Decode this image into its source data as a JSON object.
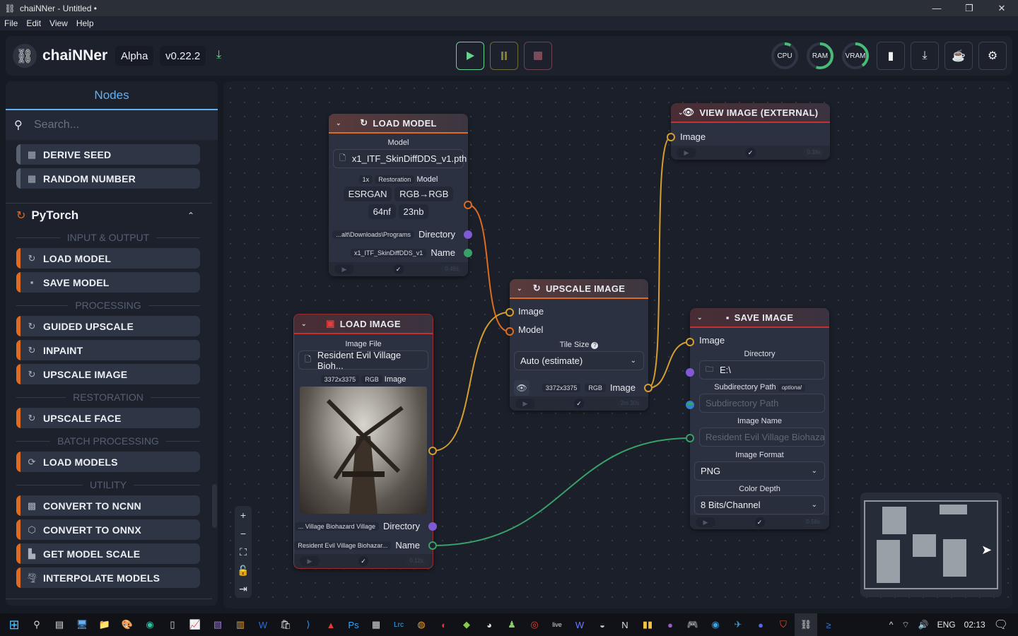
{
  "window": {
    "title": "chaiNNer - Untitled •",
    "controls": [
      "minimize",
      "restore",
      "close"
    ]
  },
  "menu": [
    "File",
    "Edit",
    "View",
    "Help"
  ],
  "header": {
    "brand": "chaiNNer",
    "channel": "Alpha",
    "version": "v0.22.2",
    "run_controls": [
      {
        "name": "run",
        "icon": "play-icon",
        "color": "#68d391"
      },
      {
        "name": "pause",
        "icon": "pause-icon",
        "color": "#7f7a3e"
      },
      {
        "name": "stop",
        "icon": "stop-icon",
        "color": "#7a4b58"
      }
    ],
    "gauges": [
      {
        "label": "CPU",
        "percent": 8
      },
      {
        "label": "RAM",
        "percent": 55
      },
      {
        "label": "VRAM",
        "percent": 40
      }
    ],
    "accent_green": "#48bb78"
  },
  "sidebar": {
    "tab": "Nodes",
    "search_placeholder": "Search...",
    "utility_items": [
      {
        "label": "DERIVE SEED",
        "icon": "calculator-icon"
      },
      {
        "label": "RANDOM NUMBER",
        "icon": "calculator-icon"
      }
    ],
    "category": {
      "name": "PyTorch",
      "color": "#dd6b20"
    },
    "sections": [
      {
        "title": "INPUT & OUTPUT",
        "items": [
          {
            "label": "LOAD MODEL",
            "icon": "pytorch-icon"
          },
          {
            "label": "SAVE MODEL",
            "icon": "save-icon"
          }
        ]
      },
      {
        "title": "PROCESSING",
        "items": [
          {
            "label": "GUIDED UPSCALE",
            "icon": "pytorch-icon"
          },
          {
            "label": "INPAINT",
            "icon": "pytorch-icon"
          },
          {
            "label": "UPSCALE IMAGE",
            "icon": "pytorch-icon"
          }
        ]
      },
      {
        "title": "RESTORATION",
        "items": [
          {
            "label": "UPSCALE FACE",
            "icon": "pytorch-icon"
          }
        ]
      },
      {
        "title": "BATCH PROCESSING",
        "items": [
          {
            "label": "LOAD MODELS",
            "icon": "loop-icon"
          }
        ]
      },
      {
        "title": "UTILITY",
        "items": [
          {
            "label": "CONVERT TO NCNN",
            "icon": "ncnn-icon"
          },
          {
            "label": "CONVERT TO ONNX",
            "icon": "onnx-icon"
          },
          {
            "label": "GET MODEL SCALE",
            "icon": "ruler-icon"
          },
          {
            "label": "INTERPOLATE MODELS",
            "icon": "tornado-icon"
          }
        ]
      }
    ]
  },
  "nodes": {
    "load_model": {
      "title": "LOAD MODEL",
      "model_label": "Model",
      "model_file": "x1_ITF_SkinDiffDDS_v1.pth",
      "tags": [
        "1x",
        "Restoration"
      ],
      "output_label": "Model",
      "chips": [
        "ESRGAN",
        "RGB→RGB",
        "64nf",
        "23nb"
      ],
      "directory_value": "...alt\\Downloads\\Programs",
      "directory_label": "Directory",
      "name_value": "x1_ITF_SkinDiffDDS_v1",
      "name_label": "Name",
      "time": "0.46s"
    },
    "load_image": {
      "title": "LOAD IMAGE",
      "file_label": "Image File",
      "file_value": "Resident Evil  Village Bioh...",
      "dims": "3372x3375",
      "channels": "RGB",
      "output_label": "Image",
      "directory_value": "... Village Biohazard Village",
      "directory_label": "Directory",
      "name_value": "Resident Evil  Village Biohazar...",
      "name_label": "Name",
      "time": "0.12s"
    },
    "upscale_image": {
      "title": "UPSCALE IMAGE",
      "input_image": "Image",
      "input_model": "Model",
      "tile_label": "Tile Size",
      "tile_value": "Auto (estimate)",
      "dims": "3372x3375",
      "channels": "RGB",
      "output_label": "Image",
      "time": "2m 30s"
    },
    "view_image": {
      "title": "VIEW IMAGE (EXTERNAL)",
      "input_image": "Image",
      "time": "0.38s"
    },
    "save_image": {
      "title": "SAVE IMAGE",
      "input_image": "Image",
      "directory_label": "Directory",
      "directory_value": "E:\\",
      "subdir_label": "Subdirectory Path",
      "subdir_optional": "optional",
      "subdir_placeholder": "Subdirectory Path",
      "name_label": "Image Name",
      "name_placeholder": "Resident Evil  Village Biohaza",
      "format_label": "Image Format",
      "format_value": "PNG",
      "depth_label": "Color Depth",
      "depth_value": "8 Bits/Channel",
      "time": "0.58s"
    }
  },
  "colors": {
    "image_handle": "#d69e2e",
    "model_handle": "#dd6b20",
    "directory_handle": "#805ad5",
    "name_handle": "#38a169",
    "pytorch_accent": "#dd6b20",
    "image_accent": "#c53030"
  },
  "taskbar": {
    "tray": {
      "lang": "ENG",
      "time": "02:13"
    }
  }
}
